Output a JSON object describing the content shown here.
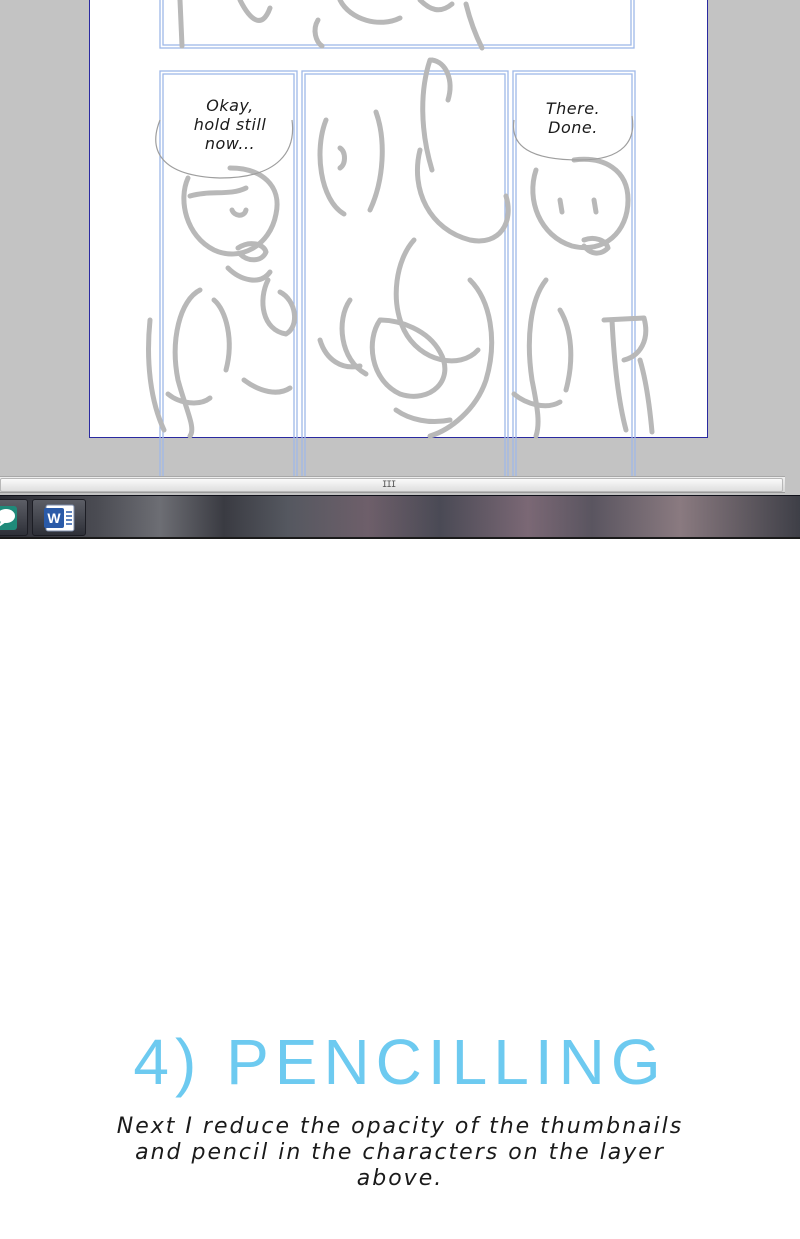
{
  "canvas": {
    "balloons": [
      {
        "text": "Okay,\nhold still\nnow..."
      },
      {
        "text": "There.\nDone."
      }
    ]
  },
  "scrollbar": {
    "grip": "III"
  },
  "taskbar": {
    "items": [
      {
        "icon": "chat-bubble-icon"
      },
      {
        "icon": "word-icon",
        "glyph": "W"
      }
    ]
  },
  "section": {
    "heading": "4) PENCILLING",
    "body": "Next I reduce the opacity of the thumbnails and pencil in the characters on the layer above."
  },
  "colors": {
    "heading": "#6dcaf0",
    "guides": "#9fb8e8",
    "sketch": "#b5b5b5",
    "workspace": "#c3c3c3"
  }
}
